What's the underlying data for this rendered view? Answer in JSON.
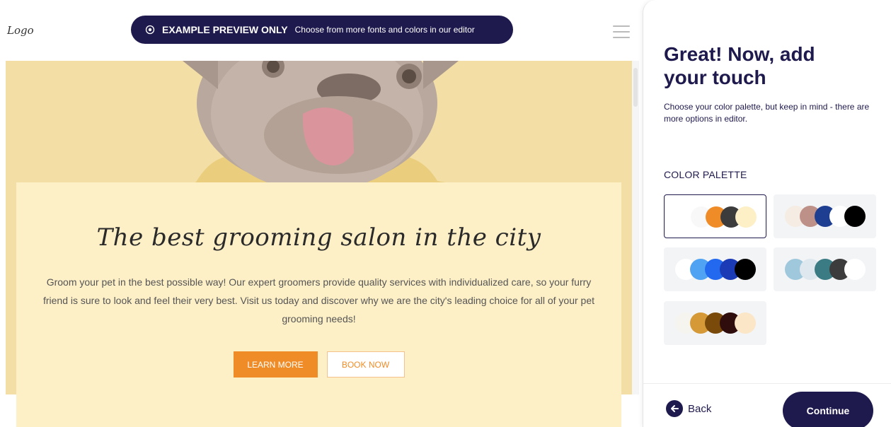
{
  "preview": {
    "logo": "Logo",
    "banner_bold": "EXAMPLE PREVIEW ONLY",
    "banner_text": "Choose from more fonts and colors in our editor",
    "hero": {
      "title": "The best grooming salon in the city",
      "description": "Groom your pet in the best possible way! Our expert groomers provide quality services with individualized care, so your furry friend is sure to look and feel their very best. Visit us today and discover why we are the city's leading choice for all of your pet grooming needs!",
      "learn_more": "LEARN MORE",
      "book_now": "BOOK NOW"
    }
  },
  "panel": {
    "title": "Great! Now, add your touch",
    "subtitle": "Choose your color palette, but keep in mind - there are more options in editor.",
    "palette_label": "COLOR PALETTE",
    "back": "Back",
    "continue": "Continue"
  },
  "palettes": [
    {
      "selected": true,
      "colors": [
        "#ffffff",
        "#f8f8f8",
        "#f08c27",
        "#3c3c3c",
        "#fdefc6"
      ]
    },
    {
      "selected": false,
      "colors": [
        "#f5ece3",
        "#bd9188",
        "#1d3e91",
        "#ffffff",
        "#000000"
      ]
    },
    {
      "selected": false,
      "colors": [
        "#ffffff",
        "#4fa3f2",
        "#2369f0",
        "#1b3ab5",
        "#000000"
      ]
    },
    {
      "selected": false,
      "colors": [
        "#9fc8dc",
        "#dfe8ee",
        "#3a7b84",
        "#3c3c3c",
        "#ffffff"
      ]
    },
    {
      "selected": false,
      "colors": [
        "#f6f4ef",
        "#d59a37",
        "#7a4a0b",
        "#2f0d0d",
        "#fbe6c7"
      ]
    }
  ],
  "colors": {
    "brand_navy": "#1f1a4d",
    "accent_orange": "#f08c27",
    "hero_yellow": "#f3dfa6",
    "card_cream": "#fdefc6"
  },
  "icons": {
    "eye": "eye-icon",
    "menu": "hamburger-menu-icon",
    "back": "arrow-left-icon"
  }
}
